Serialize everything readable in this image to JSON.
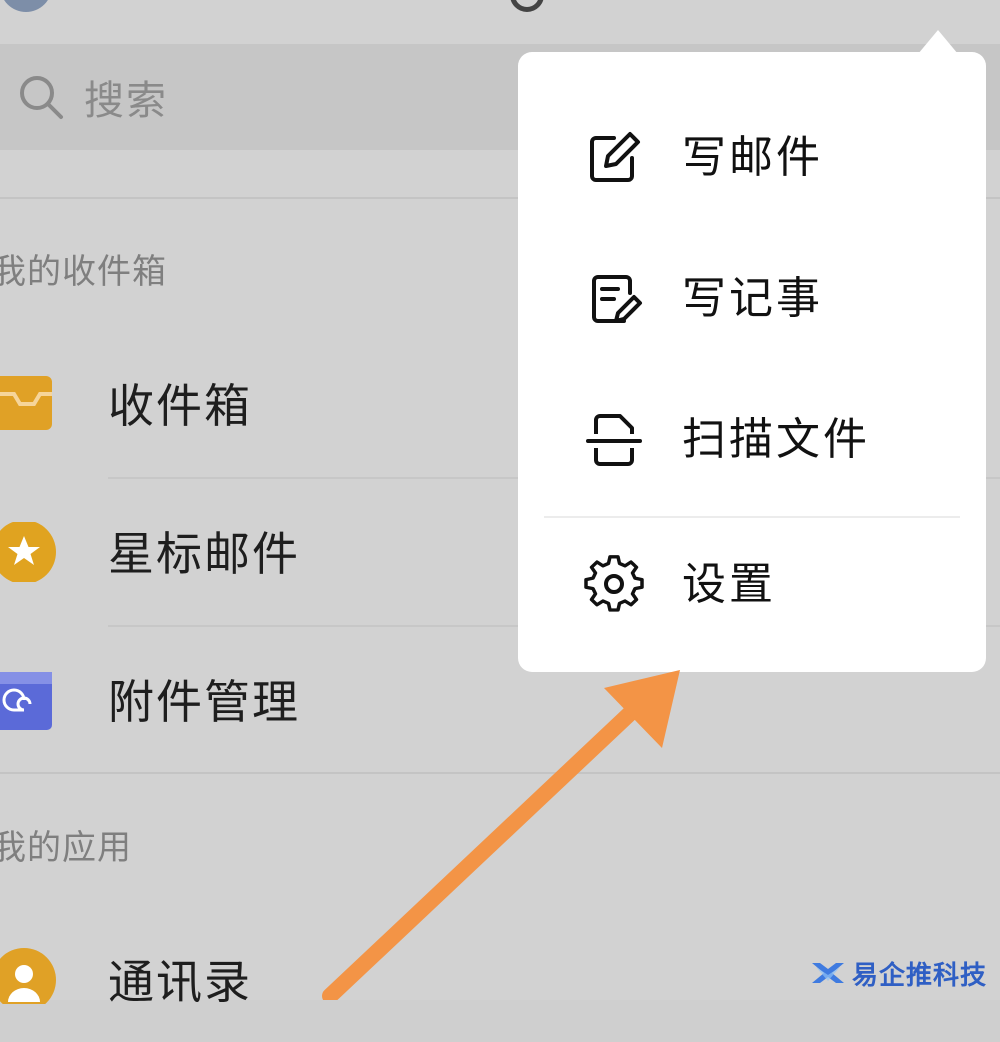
{
  "search": {
    "placeholder": "搜索"
  },
  "sections": {
    "mailbox_title": "我的收件箱",
    "apps_title": "我的应用"
  },
  "mailbox_items": [
    {
      "label": "收件箱",
      "icon": "inbox-tray-icon",
      "color": "#e0a126"
    },
    {
      "label": "星标邮件",
      "icon": "star-icon",
      "color": "#e0a320"
    },
    {
      "label": "附件管理",
      "icon": "attachment-icon",
      "color": "#5b6ad8"
    }
  ],
  "app_items": [
    {
      "label": "通讯录",
      "icon": "contact-person-icon",
      "color": "#e0a126"
    }
  ],
  "popup_menu": {
    "items": [
      {
        "label": "写邮件",
        "icon": "compose-edit-icon"
      },
      {
        "label": "写记事",
        "icon": "note-edit-icon"
      },
      {
        "label": "扫描文件",
        "icon": "scan-document-icon"
      },
      {
        "label": "设置",
        "icon": "gear-icon"
      }
    ]
  },
  "annotation": {
    "arrow_color": "#f39446"
  },
  "watermark": {
    "text": "易企推科技",
    "color": "#2f5fc4"
  }
}
